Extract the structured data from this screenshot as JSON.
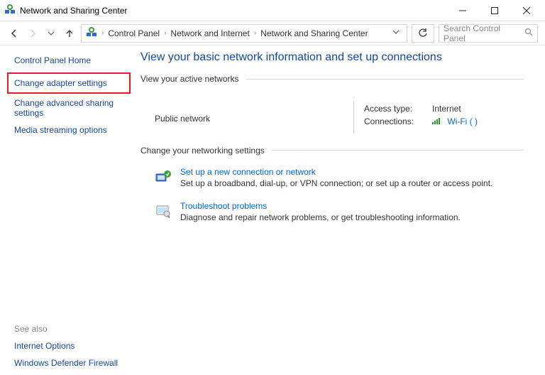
{
  "titlebar": {
    "text": "Network and Sharing Center"
  },
  "breadcrumb": {
    "items": [
      "Control Panel",
      "Network and Internet",
      "Network and Sharing Center"
    ]
  },
  "search": {
    "placeholder": "Search Control Panel"
  },
  "sidebar": {
    "home": "Control Panel Home",
    "adapter": "Change adapter settings",
    "advanced": "Change advanced sharing settings",
    "media": "Media streaming options",
    "see_also_label": "See also",
    "internet_options": "Internet Options",
    "firewall": "Windows Defender Firewall"
  },
  "content": {
    "title": "View your basic network information and set up connections",
    "active_label": "View your active networks",
    "network_name": "Public network",
    "access_type_label": "Access type:",
    "access_type_value": "Internet",
    "connections_label": "Connections:",
    "connections_value": "Wi-Fi (         )",
    "settings_label": "Change your networking settings",
    "item1_link": "Set up a new connection or network",
    "item1_desc": "Set up a broadband, dial-up, or VPN connection; or set up a router or access point.",
    "item2_link": "Troubleshoot problems",
    "item2_desc": "Diagnose and repair network problems, or get troubleshooting information."
  }
}
